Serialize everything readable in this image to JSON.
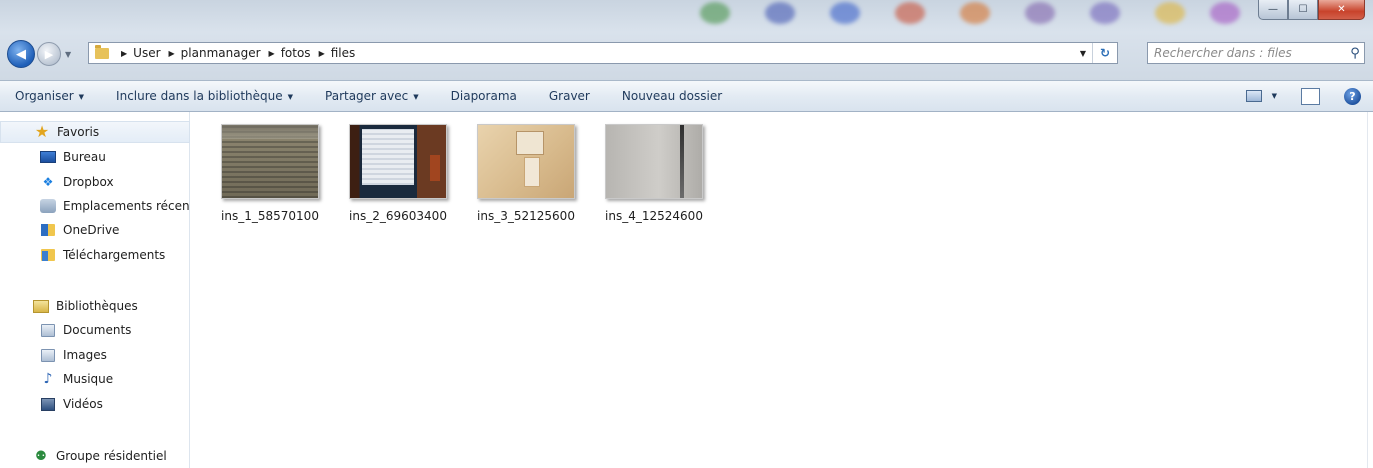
{
  "window": {
    "minimize_glyph": "—",
    "maximize_glyph": "☐",
    "close_glyph": "✕"
  },
  "navigation": {
    "back_glyph": "◀",
    "forward_glyph": "▶",
    "history_glyph": "▼"
  },
  "address": {
    "path": [
      "User",
      "planmanager",
      "fotos",
      "files"
    ],
    "separator": "▶",
    "dropdown_glyph": "▼",
    "refresh_glyph": "↻"
  },
  "search": {
    "placeholder": "Rechercher dans : files",
    "icon": "search-icon"
  },
  "toolbar": {
    "organize_label": "Organiser",
    "include_label": "Inclure dans la bibliothèque",
    "share_label": "Partager avec",
    "slideshow_label": "Diaporama",
    "burn_label": "Graver",
    "new_folder_label": "Nouveau dossier",
    "dropdown_glyph": "▼",
    "help_label": "?"
  },
  "sidebar": {
    "favorites": {
      "label": "Favoris",
      "icon": "star-icon",
      "items": [
        {
          "label": "Bureau",
          "icon": "desktop-icon"
        },
        {
          "label": "Dropbox",
          "icon": "dropbox-icon"
        },
        {
          "label": "Emplacements récen",
          "icon": "recent-places-icon"
        },
        {
          "label": "OneDrive",
          "icon": "onedrive-folder-icon"
        },
        {
          "label": "Téléchargements",
          "icon": "downloads-folder-icon"
        }
      ]
    },
    "libraries": {
      "label": "Bibliothèques",
      "icon": "libraries-icon",
      "items": [
        {
          "label": "Documents",
          "icon": "documents-icon"
        },
        {
          "label": "Images",
          "icon": "pictures-icon"
        },
        {
          "label": "Musique",
          "icon": "music-icon"
        },
        {
          "label": "Vidéos",
          "icon": "videos-icon"
        }
      ]
    },
    "homegroup": {
      "label": "Groupe résidentiel",
      "icon": "homegroup-icon"
    }
  },
  "files": [
    {
      "name": "ins_1_58570100"
    },
    {
      "name": "ins_2_69603400"
    },
    {
      "name": "ins_3_52125600"
    },
    {
      "name": "ins_4_12524600"
    }
  ],
  "colors": {
    "command_text": "#1e395b",
    "selection_bg": "#e4edf7",
    "close_button": "#c8432b"
  }
}
